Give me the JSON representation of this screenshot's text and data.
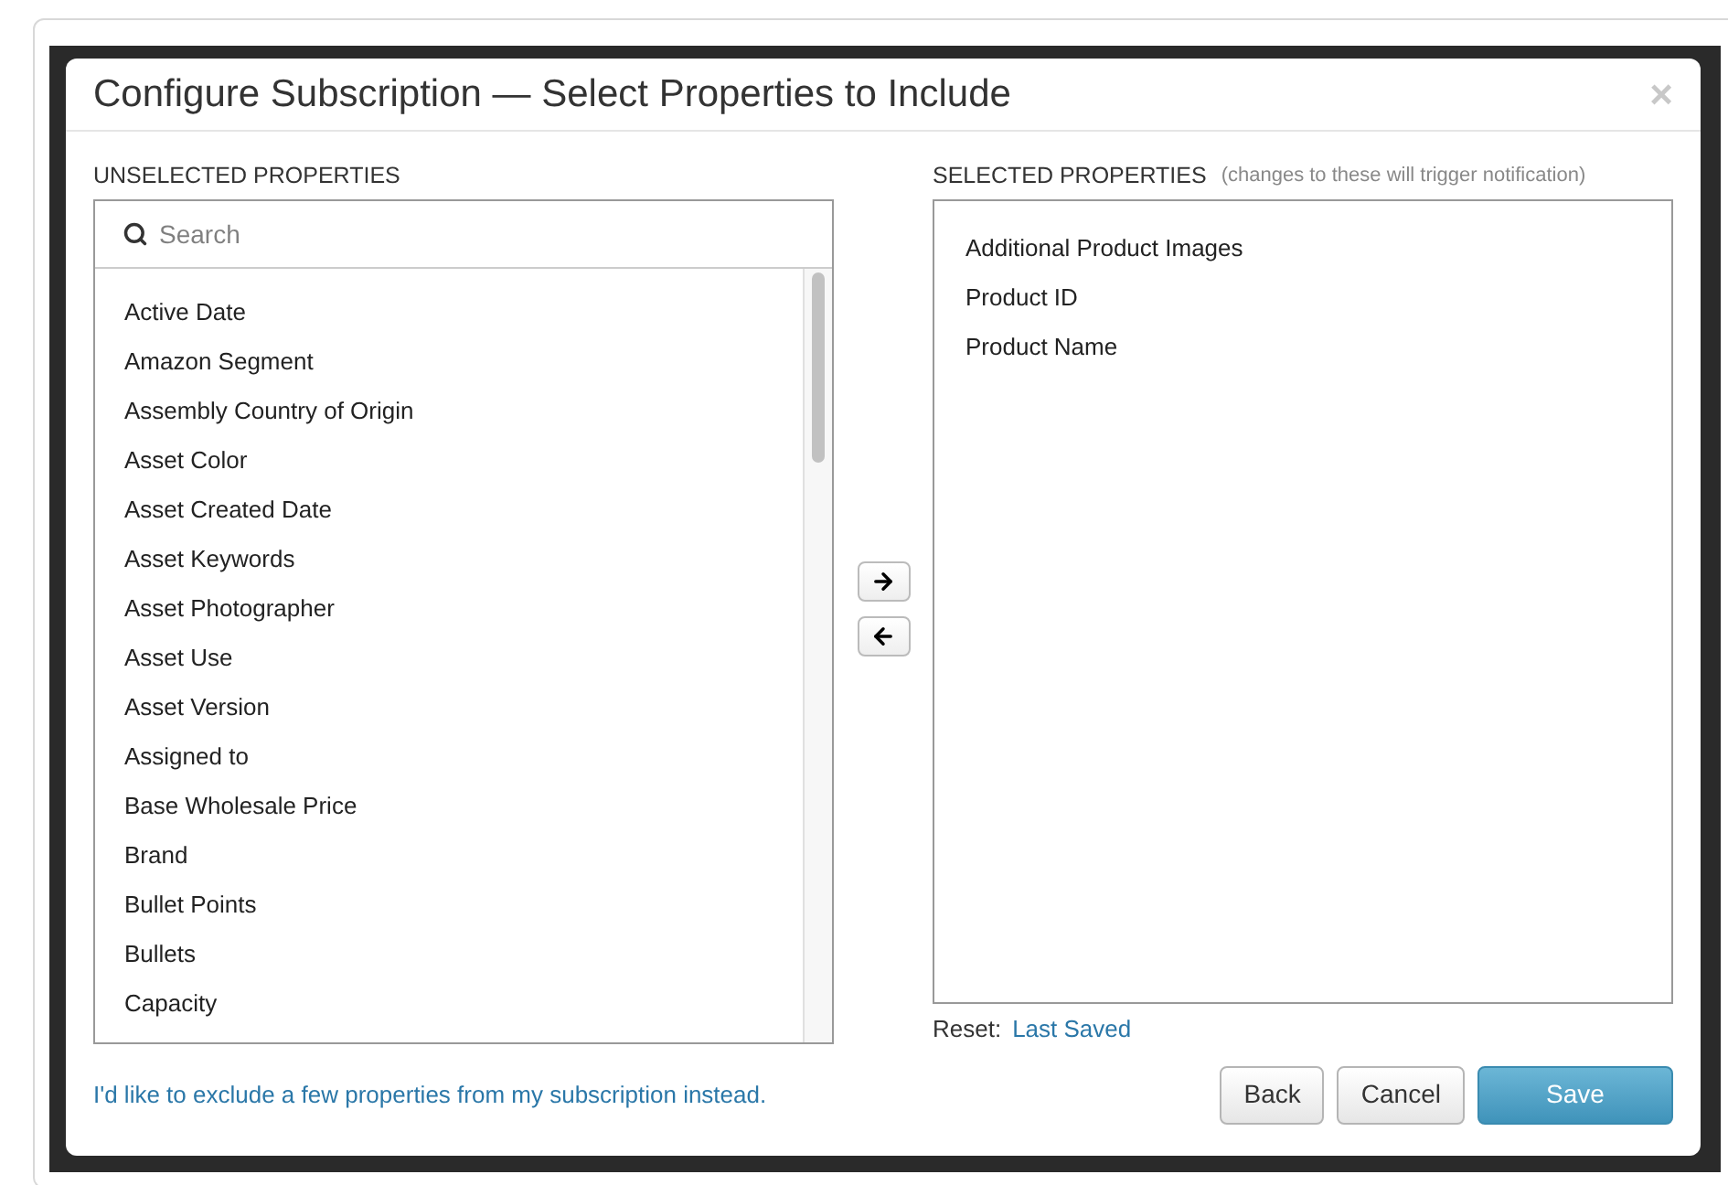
{
  "dialog": {
    "title": "Configure Subscription — Select Properties to Include",
    "close": "×"
  },
  "unselected": {
    "heading": "UNSELECTED PROPERTIES",
    "search": {
      "placeholder": "Search"
    },
    "items": [
      "Active Date",
      "Amazon Segment",
      "Assembly Country of Origin",
      "Asset Color",
      "Asset Created Date",
      "Asset Keywords",
      "Asset Photographer",
      "Asset Use",
      "Asset Version",
      "Assigned to",
      "Base Wholesale Price",
      "Brand",
      "Bullet Points",
      "Bullets",
      "Capacity"
    ]
  },
  "selected": {
    "heading": "SELECTED PROPERTIES",
    "note": "(changes to these will trigger notification)",
    "items": [
      "Additional Product Images",
      "Product ID",
      "Product Name"
    ],
    "reset_label": "Reset:",
    "reset_link": "Last Saved"
  },
  "exclude_link": "I'd like to exclude a few properties from my subscription instead.",
  "buttons": [
    {
      "label": "Back",
      "kind": "default"
    },
    {
      "label": "Cancel",
      "kind": "default"
    },
    {
      "label": "Save",
      "kind": "primary"
    }
  ]
}
